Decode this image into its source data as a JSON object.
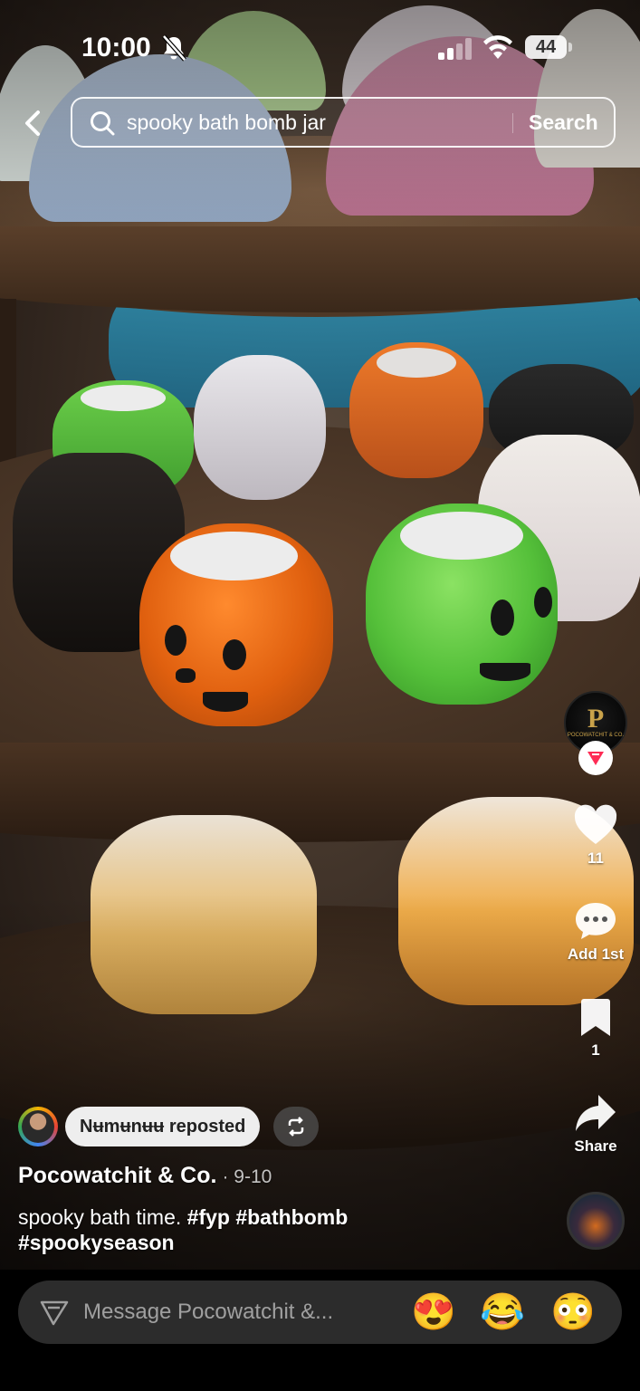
{
  "status_bar": {
    "time": "10:00",
    "battery": "44",
    "icons": [
      "bell-muted-icon",
      "signal-icon",
      "wifi-icon",
      "battery-icon"
    ]
  },
  "search": {
    "query": "spooky bath bomb jar",
    "button_label": "Search",
    "icons": [
      "back-arrow-icon",
      "search-icon"
    ]
  },
  "actions": {
    "likes": "11",
    "comments": "Add 1st",
    "bookmarks": "1",
    "share": "Share",
    "creator_avatar_text": "P",
    "creator_avatar_subtext": "POCOWATCHIT & CO."
  },
  "repost": {
    "label": "Nʉmʉnʉʉ reposted"
  },
  "post": {
    "creator": "Pocowatchit & Co.",
    "date": "· 9-10",
    "caption_text": "spooky bath time. ",
    "hashtags": [
      "#fyp",
      "#bathbomb",
      "#spookyseason"
    ]
  },
  "message_bar": {
    "placeholder": "Message Pocowatchit &...",
    "emojis": [
      "😍",
      "😂",
      "😳"
    ]
  },
  "colors": {
    "accent_red": "#fe2c55",
    "bar_bg": "#2c2c2c"
  }
}
